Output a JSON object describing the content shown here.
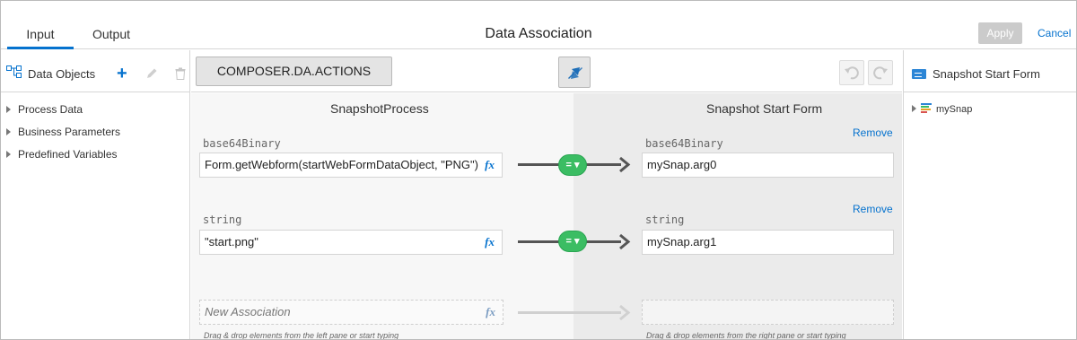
{
  "header": {
    "tabs": [
      {
        "label": "Input",
        "active": true
      },
      {
        "label": "Output",
        "active": false
      }
    ],
    "title": "Data Association",
    "apply_label": "Apply",
    "cancel_label": "Cancel"
  },
  "left_panel": {
    "title": "Data Objects",
    "items": [
      "Process Data",
      "Business Parameters",
      "Predefined Variables"
    ]
  },
  "toolbar": {
    "composer_label": "COMPOSER.DA.ACTIONS"
  },
  "mapping": {
    "left_title": "SnapshotProcess",
    "right_title": "Snapshot Start Form",
    "fx_label": "fx",
    "operator_label": "= ▾",
    "remove_label": "Remove",
    "rows": [
      {
        "left_type": "base64Binary",
        "left_value": "Form.getWebform(startWebFormDataObject, \"PNG\")",
        "right_type": "base64Binary",
        "right_value": "mySnap.arg0"
      },
      {
        "left_type": "string",
        "left_value": "\"start.png\"",
        "right_type": "string",
        "right_value": "mySnap.arg1"
      }
    ],
    "new_association_placeholder": "New Association",
    "left_hint": "Drag & drop elements from the left pane or start typing",
    "right_hint": "Drag & drop elements from the right pane or start typing"
  },
  "right_panel": {
    "title": "Snapshot Start Form",
    "tree_item": "mySnap"
  },
  "colors": {
    "accent": "#0572ce",
    "operator": "#3bbd63"
  }
}
